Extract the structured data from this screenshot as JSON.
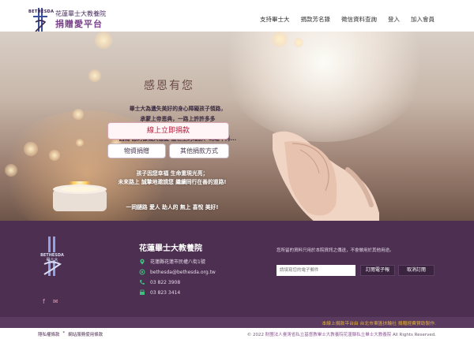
{
  "header": {
    "logo_en": "BETHESDA",
    "logo_line1": "花蓮畢士大教養院",
    "logo_line2": "捐贈愛平台",
    "nav": [
      "支持畢士大",
      "捐款芳名錄",
      "徵信資料查詢",
      "登入",
      "加入會員"
    ]
  },
  "hero": {
    "title": "感恩有您",
    "lines": [
      "畢士大為遺失美好的身心障礙孩子領路，",
      "承蒙上帝恩典，一路上許許多多",
      "良善　樸實　美麗的善心天使 以愛捐輸灌溉；",
      "因為 您的慷慨與慈愛 這世上的暗影、崎嶇不再..."
    ],
    "donate_online": "線上立即捐款",
    "donate_goods": "物資捐贈",
    "donate_other": "其他捐款方式",
    "lines2": [
      "孩子因您幸福 生命重現光亮；",
      "未來路上 誠摯地邀請您 繼續同行在善的道路!"
    ],
    "closing": "一同鏈路 愛人 助人的 無上 喜悅 美好!"
  },
  "footer": {
    "logo_en": "BETHESDA",
    "logo_zh": "畢士大",
    "org_name": "花蓮畢士大教養院",
    "address": "花蓮縣花蓮市民權八街1號",
    "email": "bethesda@bethesda.org.tw",
    "phone": "03 822 3908",
    "fax": "03 823 3414",
    "subscribe_note": "您所留的資料只用於本院資訊之傳送，不會做用於其他用途。",
    "email_placeholder": "請填寫您的電子郵件",
    "subscribe_label": "訂閱電子報",
    "unsubscribe_label": "取消訂閱",
    "band_text": "本線上捐款平台由 台北市東區扶輪社 捐贈經費贊助製作.",
    "policy_privacy": "隱私權條款",
    "policy_sep": "*",
    "policy_terms": "網站服務使用條款",
    "copyright_prefix": "© 2022 ",
    "copyright_org": "財團法人臺灣省私立基督教畢士大教養院花蓮縣私立畢士大教養院",
    "copyright_suffix": " All Rights Reserved."
  },
  "colors": {
    "brand_purple": "#4d2f51",
    "accent_red": "#b0213c",
    "band_gold": "#e8b33a"
  },
  "icons": [
    "logo-cross-icon",
    "location-icon",
    "mail-icon",
    "phone-icon",
    "fax-icon",
    "facebook-icon",
    "envelope-icon"
  ]
}
